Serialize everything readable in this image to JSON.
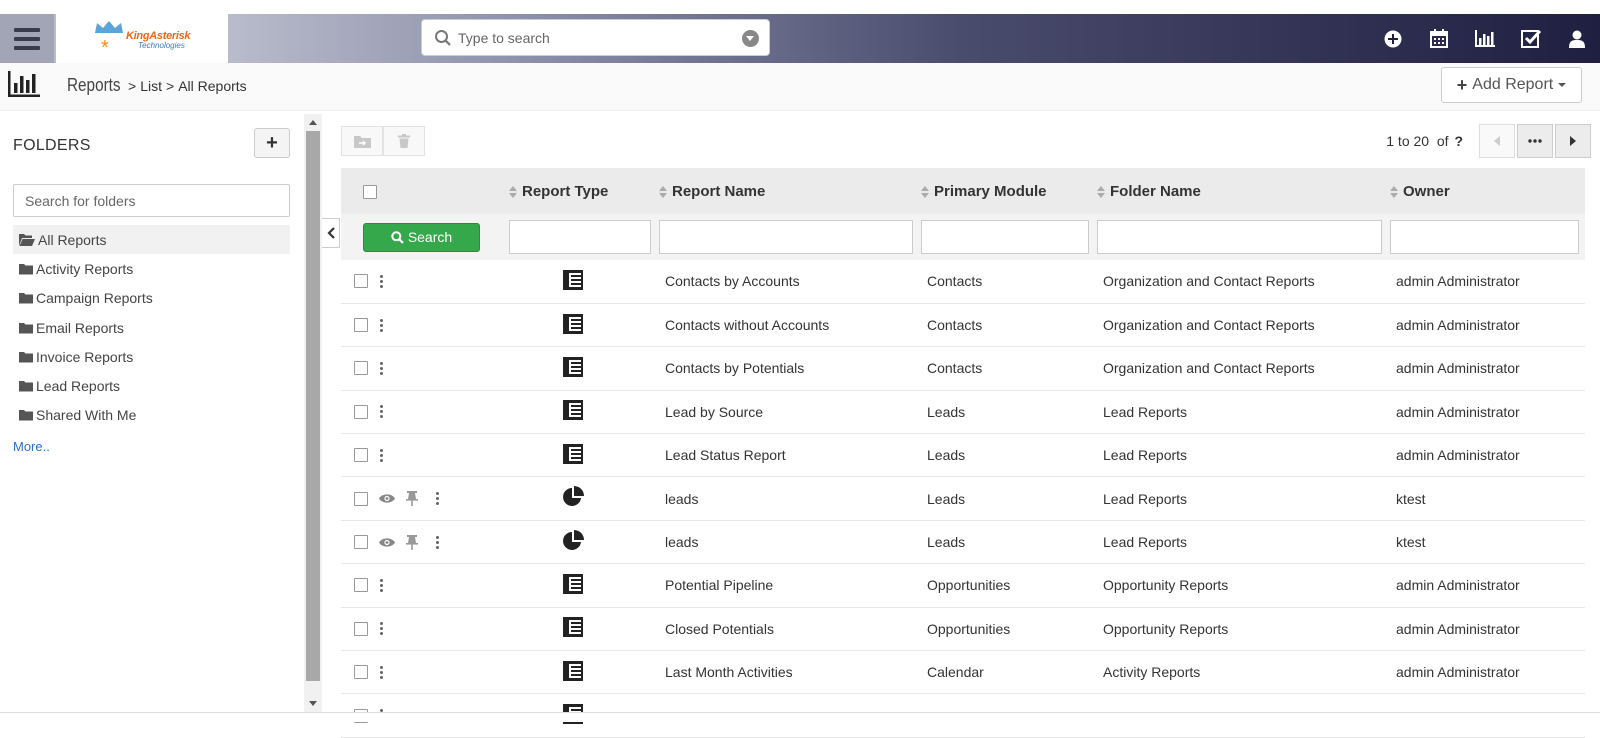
{
  "topbar": {
    "search_placeholder": "Type to search",
    "logo_brand": "KingAsterisk",
    "logo_sub": "Technologies",
    "icons": [
      "plus-circle-icon",
      "calendar-icon",
      "bar-chart-icon",
      "checkbox-icon",
      "user-icon"
    ]
  },
  "breadcrumb": {
    "module": "Reports",
    "sep": ">",
    "list": "List",
    "current": "All Reports"
  },
  "add_report_label": "Add Report",
  "sidebar": {
    "heading": "FOLDERS",
    "add_label": "+",
    "search_placeholder": "Search for folders",
    "folders": [
      {
        "label": "All Reports",
        "active": true
      },
      {
        "label": "Activity Reports"
      },
      {
        "label": "Campaign Reports"
      },
      {
        "label": "Email Reports"
      },
      {
        "label": "Invoice Reports"
      },
      {
        "label": "Lead Reports"
      },
      {
        "label": "Shared With Me"
      }
    ],
    "more_label": "More.."
  },
  "pager": {
    "range": "1 to 20",
    "of": "of",
    "total": "?"
  },
  "table": {
    "headers": [
      "Report Type",
      "Report Name",
      "Primary Module",
      "Folder Name",
      "Owner"
    ],
    "search_label": "Search",
    "rows": [
      {
        "type": "table",
        "name": "Contacts by Accounts",
        "module": "Contacts",
        "folder": "Organization and Contact Reports",
        "owner": "admin Administrator",
        "extra": false
      },
      {
        "type": "table",
        "name": "Contacts without Accounts",
        "module": "Contacts",
        "folder": "Organization and Contact Reports",
        "owner": "admin Administrator",
        "extra": false
      },
      {
        "type": "table",
        "name": "Contacts by Potentials",
        "module": "Contacts",
        "folder": "Organization and Contact Reports",
        "owner": "admin Administrator",
        "extra": false
      },
      {
        "type": "table",
        "name": "Lead by Source",
        "module": "Leads",
        "folder": "Lead Reports",
        "owner": "admin Administrator",
        "extra": false
      },
      {
        "type": "table",
        "name": "Lead Status Report",
        "module": "Leads",
        "folder": "Lead Reports",
        "owner": "admin Administrator",
        "extra": false
      },
      {
        "type": "pie",
        "name": "leads",
        "module": "Leads",
        "folder": "Lead Reports",
        "owner": "ktest",
        "extra": true
      },
      {
        "type": "pie",
        "name": "leads",
        "module": "Leads",
        "folder": "Lead Reports",
        "owner": "ktest",
        "extra": true
      },
      {
        "type": "table",
        "name": "Potential Pipeline",
        "module": "Opportunities",
        "folder": "Opportunity Reports",
        "owner": "admin Administrator",
        "extra": false
      },
      {
        "type": "table",
        "name": "Closed Potentials",
        "module": "Opportunities",
        "folder": "Opportunity Reports",
        "owner": "admin Administrator",
        "extra": false
      },
      {
        "type": "table",
        "name": "Last Month Activities",
        "module": "Calendar",
        "folder": "Activity Reports",
        "owner": "admin Administrator",
        "extra": false
      },
      {
        "type": "table",
        "name": "",
        "module": "",
        "folder": "",
        "owner": "",
        "extra": false
      }
    ]
  }
}
